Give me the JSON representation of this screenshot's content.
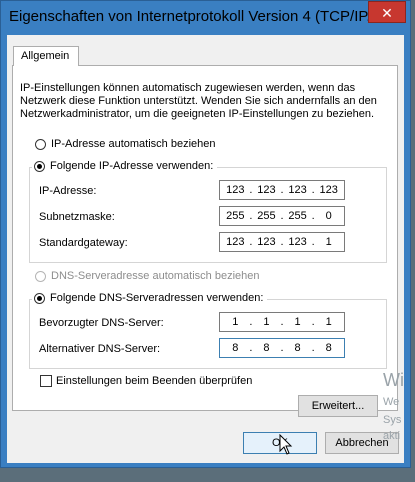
{
  "window": {
    "title": "Eigenschaften von Internetprotokoll Version 4 (TCP/IP...",
    "close_glyph": "✕"
  },
  "tabs": [
    {
      "label": "Allgemein"
    }
  ],
  "description": "IP-Einstellungen können automatisch zugewiesen werden, wenn das Netzwerk diese Funktion unterstützt. Wenden Sie sich andernfalls an den Netzwerkadministrator, um die geeigneten IP-Einstellungen zu beziehen.",
  "ip": {
    "auto_label": "IP-Adresse automatisch beziehen",
    "auto_selected": false,
    "manual_label": "Folgende IP-Adresse verwenden:",
    "manual_selected": true,
    "fields": [
      {
        "label": "IP-Adresse:",
        "octets": [
          "123",
          "123",
          "123",
          "123"
        ]
      },
      {
        "label": "Subnetzmaske:",
        "octets": [
          "255",
          "255",
          "255",
          "0"
        ]
      },
      {
        "label": "Standardgateway:",
        "octets": [
          "123",
          "123",
          "123",
          "1"
        ]
      }
    ]
  },
  "dns": {
    "auto_label": "DNS-Serveradresse automatisch beziehen",
    "auto_selected": false,
    "auto_disabled": true,
    "manual_label": "Folgende DNS-Serveradressen verwenden:",
    "manual_selected": true,
    "fields": [
      {
        "label": "Bevorzugter DNS-Server:",
        "octets": [
          "1",
          "1",
          "1",
          "1"
        ]
      },
      {
        "label": "Alternativer DNS-Server:",
        "octets": [
          "8",
          "8",
          "8",
          "8"
        ]
      }
    ]
  },
  "validate_on_exit": {
    "label": "Einstellungen beim Beenden überprüfen",
    "checked": false
  },
  "buttons": {
    "advanced": "Erweitert...",
    "ok": "OK",
    "cancel": "Abbrechen"
  },
  "watermark": {
    "line1": "Wi",
    "line2": "We",
    "line3": "Sys",
    "line4": "akti"
  },
  "colors": {
    "titlebar": "#3a7fc2",
    "close": "#c7372f",
    "focus": "#3c7fb1"
  }
}
